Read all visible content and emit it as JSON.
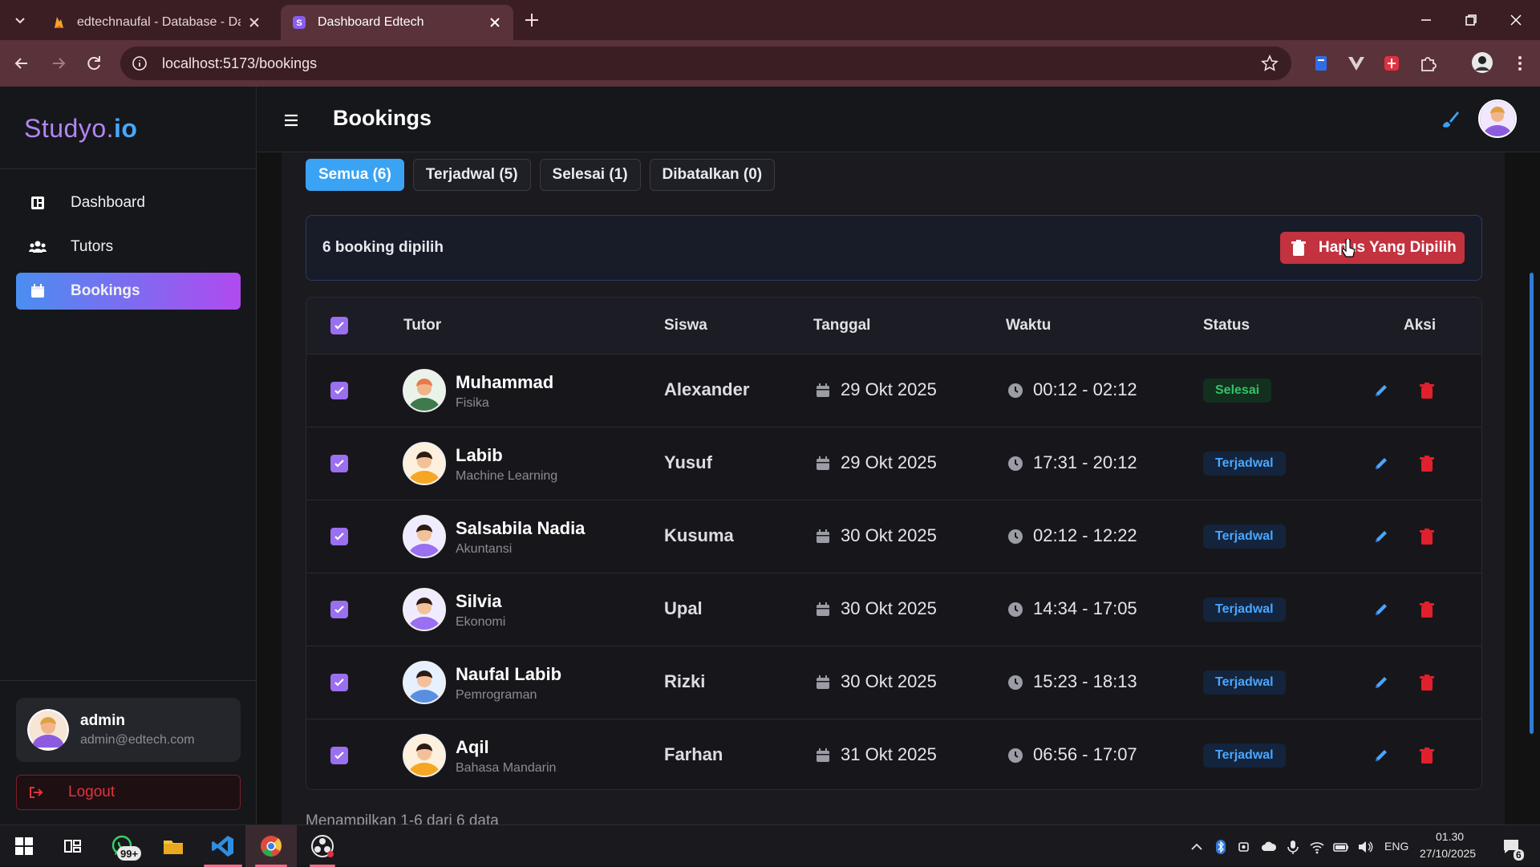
{
  "browser": {
    "tabs": [
      {
        "title": "edtechnaufal - Database - Data",
        "active": false
      },
      {
        "title": "Dashboard Edtech",
        "active": true
      }
    ],
    "url": "localhost:5173/bookings"
  },
  "app": {
    "logo_main": "Studyo.",
    "logo_suffix": "io",
    "page_title": "Bookings"
  },
  "sidebar": {
    "items": [
      {
        "label": "Dashboard",
        "icon": "dashboard-icon",
        "active": false
      },
      {
        "label": "Tutors",
        "icon": "users-icon",
        "active": false
      },
      {
        "label": "Bookings",
        "icon": "calendar-icon",
        "active": true
      }
    ],
    "user": {
      "name": "admin",
      "email": "admin@edtech.com"
    },
    "logout_label": "Logout"
  },
  "filters": [
    {
      "label": "Semua (6)",
      "active": true
    },
    {
      "label": "Terjadwal (5)",
      "active": false
    },
    {
      "label": "Selesai (1)",
      "active": false
    },
    {
      "label": "Dibatalkan (0)",
      "active": false
    }
  ],
  "selection": {
    "text": "6 booking dipilih",
    "delete_label": "Hapus Yang Dipilih"
  },
  "table": {
    "columns": [
      "Tutor",
      "Siswa",
      "Tanggal",
      "Waktu",
      "Status",
      "Aksi"
    ],
    "rows": [
      {
        "tutor": "Muhammad",
        "subject": "Fisika",
        "siswa": "Alexander",
        "tanggal": "29 Okt 2025",
        "waktu": "00:12 - 02:12",
        "status": "Selesai",
        "status_type": "done"
      },
      {
        "tutor": "Labib",
        "subject": "Machine Learning",
        "siswa": "Yusuf",
        "tanggal": "29 Okt 2025",
        "waktu": "17:31 - 20:12",
        "status": "Terjadwal",
        "status_type": "sched"
      },
      {
        "tutor": "Salsabila Nadia",
        "subject": "Akuntansi",
        "siswa": "Kusuma",
        "tanggal": "30 Okt 2025",
        "waktu": "02:12 - 12:22",
        "status": "Terjadwal",
        "status_type": "sched"
      },
      {
        "tutor": "Silvia",
        "subject": "Ekonomi",
        "siswa": "Upal",
        "tanggal": "30 Okt 2025",
        "waktu": "14:34 - 17:05",
        "status": "Terjadwal",
        "status_type": "sched"
      },
      {
        "tutor": "Naufal Labib",
        "subject": "Pemrograman",
        "siswa": "Rizki",
        "tanggal": "30 Okt 2025",
        "waktu": "15:23 - 18:13",
        "status": "Terjadwal",
        "status_type": "sched"
      },
      {
        "tutor": "Aqil",
        "subject": "Bahasa Mandarin",
        "siswa": "Farhan",
        "tanggal": "31 Okt 2025",
        "waktu": "06:56 - 17:07",
        "status": "Terjadwal",
        "status_type": "sched"
      }
    ],
    "footer": "Menampilkan 1-6 dari 6 data"
  },
  "taskbar": {
    "whatsapp_badge": "99+",
    "language": "ENG",
    "time": "01.30",
    "date": "27/10/2025",
    "notifications": "6"
  },
  "colors": {
    "accent_blue": "#3aa3f3",
    "accent_purple": "#9a6ff0",
    "danger": "#c2323f",
    "status_done": "#35c06a",
    "status_scheduled": "#4aa6ff"
  }
}
